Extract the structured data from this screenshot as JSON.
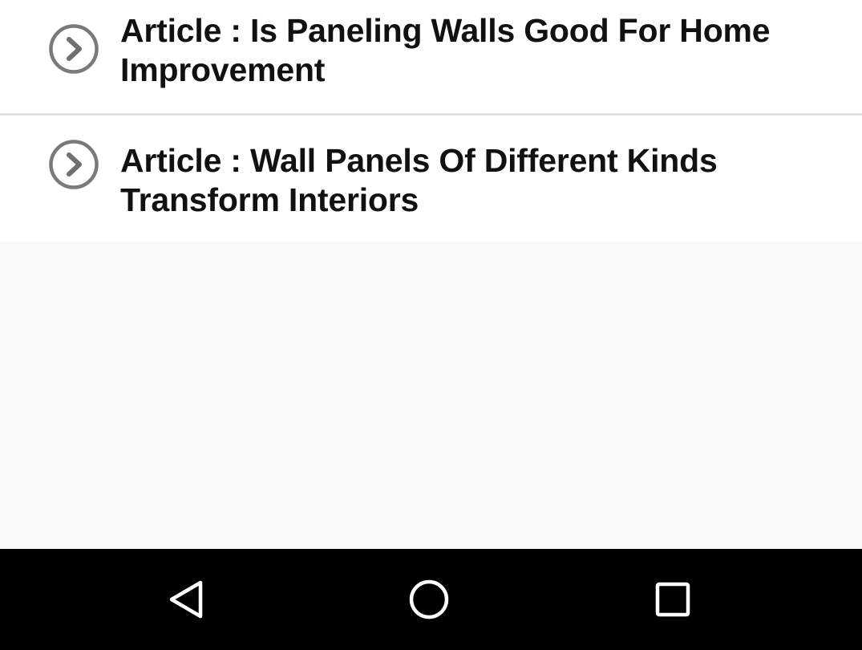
{
  "articles": [
    {
      "title": "Article : Is Paneling Walls Good For Home Improvement",
      "icon": "chevron-circle-right-icon"
    },
    {
      "title": "Article : Wall Panels Of Different Kinds Transform Interiors",
      "icon": "chevron-circle-right-icon"
    }
  ],
  "navbar": {
    "back_icon": "back-triangle-icon",
    "home_icon": "home-circle-icon",
    "recents_icon": "recents-square-icon"
  },
  "colors": {
    "background": "#f9f9f9",
    "list_background": "#ffffff",
    "divider": "#e0e0e0",
    "title_text": "#111111",
    "icon_gray": "#7a7a7a",
    "navbar": "#000000",
    "navbar_icon": "#ffffff"
  }
}
